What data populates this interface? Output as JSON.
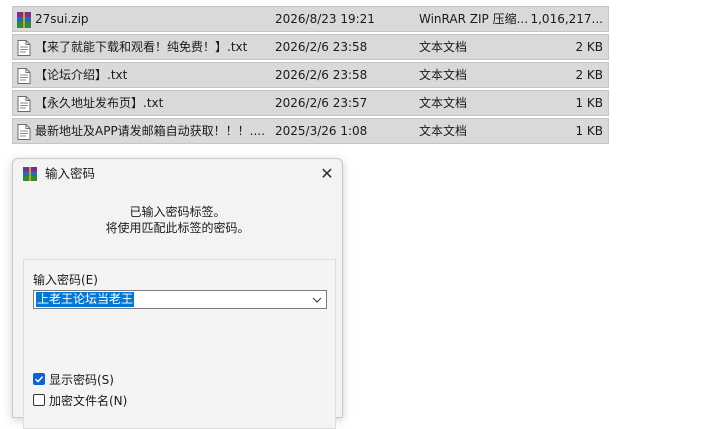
{
  "files": [
    {
      "name": "27sui.zip",
      "date": "2026/8/23 19:21",
      "type": "WinRAR ZIP 压缩...",
      "size": "1,016,217...",
      "icon": "winrar-archive-icon"
    },
    {
      "name": "【来了就能下载和观看！纯免费！】.txt",
      "date": "2026/2/6 23:58",
      "type": "文本文档",
      "size": "2 KB",
      "icon": "text-file-icon"
    },
    {
      "name": "【论坛介绍】.txt",
      "date": "2026/2/6 23:58",
      "type": "文本文档",
      "size": "2 KB",
      "icon": "text-file-icon"
    },
    {
      "name": "【永久地址发布页】.txt",
      "date": "2026/2/6 23:57",
      "type": "文本文档",
      "size": "1 KB",
      "icon": "text-file-icon"
    },
    {
      "name": "最新地址及APP请发邮箱自动获取！！！....",
      "date": "2025/3/26 1:08",
      "type": "文本文档",
      "size": "1 KB",
      "icon": "text-file-icon"
    }
  ],
  "dialog": {
    "title": "输入密码",
    "message_line1": "已输入密码标签。",
    "message_line2": "将使用匹配此标签的密码。",
    "password_label": "输入密码(E)",
    "password_value": "上老王论坛当老王",
    "show_password_label": "显示密码(S)",
    "show_password_checked": true,
    "encrypt_names_label": "加密文件名(N)",
    "encrypt_names_checked": false,
    "close_glyph": "✕"
  },
  "colors": {
    "row_bg": "#d9d9d9",
    "selection": "#0078d7",
    "checkbox_accent": "#0a64d6"
  }
}
